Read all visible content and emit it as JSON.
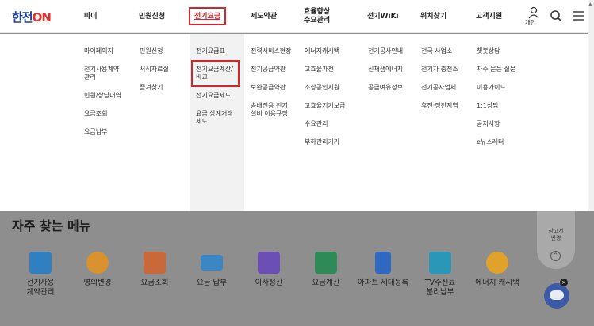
{
  "header": {
    "logo_main": "한전",
    "logo_on": "ON",
    "nav": [
      {
        "label": "마이"
      },
      {
        "label": "민원신청"
      },
      {
        "label": "전기요금"
      },
      {
        "label": "제도약관"
      },
      {
        "label": "효율향상\n수요관리"
      },
      {
        "label": "전기WiKi"
      },
      {
        "label": "위치찾기"
      },
      {
        "label": "고객지원"
      }
    ],
    "user_label": "개인"
  },
  "mega_menu": {
    "columns": [
      {
        "items": [
          "마이페이지",
          "전기사용계약\n관리",
          "민원/상담내역",
          "요금조회",
          "요금납부"
        ]
      },
      {
        "items": [
          "민원신청",
          "서식자료실",
          "즐겨찾기"
        ]
      },
      {
        "items": [
          "전기요금표",
          "전기요금계산/\n비교",
          "전기요금제도",
          "요금 상계거래\n제도"
        ]
      },
      {
        "items": [
          "전력서비스현장",
          "전기공급약관",
          "보완공급약관",
          "송배전용 전기\n설비 이용규정"
        ]
      },
      {
        "items": [
          "에너지캐시백",
          "고효율가전",
          "소상공인지원",
          "고효율기기보급",
          "수요관리",
          "부하관리기기"
        ]
      },
      {
        "items": [
          "전기공사안내",
          "신재생에너지",
          "공급여유정보"
        ]
      },
      {
        "items": [
          "전국 사업소",
          "전기차 충전소",
          "전기공사업체",
          "휴전·정전지역"
        ]
      },
      {
        "items": [
          "챗봇상담",
          "자주 묻는 질문",
          "이용가이드",
          "1:1상담",
          "공지사항",
          "e뉴스레터"
        ]
      }
    ]
  },
  "quick_menu": {
    "title_prefix": "자주 찾는 ",
    "title_bold": "메뉴",
    "items": [
      {
        "label": "전기사용\n계약관리",
        "icon": "contract-icon",
        "color": "#2f7fc1"
      },
      {
        "label": "명의변경",
        "icon": "person-change-icon",
        "color": "#d9922e"
      },
      {
        "label": "요금조회",
        "icon": "bill-icon",
        "color": "#c9693a"
      },
      {
        "label": "요금 납부",
        "icon": "card-icon",
        "color": "#3c86c4"
      },
      {
        "label": "이사정산",
        "icon": "calendar-icon",
        "color": "#6b4fb5"
      },
      {
        "label": "요금계산",
        "icon": "calculator-icon",
        "color": "#2e8b57"
      },
      {
        "label": "아파트 세대등록",
        "icon": "apartment-icon",
        "color": "#2f67c1"
      },
      {
        "label": "TV수신료\n분리납부",
        "icon": "tv-icon",
        "color": "#2b97b8"
      },
      {
        "label": "에너지 캐시백",
        "icon": "energy-icon",
        "color": "#e0a22a"
      }
    ]
  },
  "floating": {
    "label": "참고서\n변경",
    "up": "^"
  },
  "bot_close": "×"
}
